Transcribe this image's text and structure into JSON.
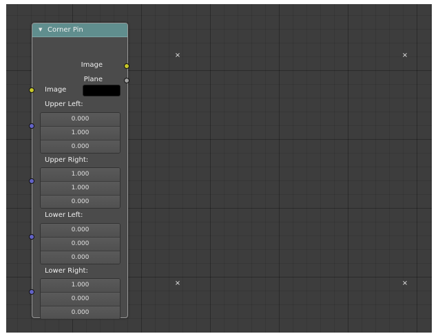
{
  "node": {
    "title": "Corner Pin",
    "outputs": {
      "image_label": "Image",
      "plane_label": "Plane"
    },
    "image_input": {
      "label": "Image",
      "color": "#000000"
    },
    "vectors": {
      "upper_left": {
        "label": "Upper Left:",
        "values": [
          "0.000",
          "1.000",
          "0.000"
        ]
      },
      "upper_right": {
        "label": "Upper Right:",
        "values": [
          "1.000",
          "1.000",
          "0.000"
        ]
      },
      "lower_left": {
        "label": "Lower Left:",
        "values": [
          "0.000",
          "0.000",
          "0.000"
        ]
      },
      "lower_right": {
        "label": "Lower Right:",
        "values": [
          "1.000",
          "0.000",
          "0.000"
        ]
      }
    }
  },
  "corner_markers": [
    "×",
    "×",
    "×",
    "×"
  ],
  "colors": {
    "header": "#608e8e",
    "image_socket": "#c7c729",
    "plane_socket": "#a1a1a1",
    "vector_socket": "#6363c7"
  }
}
